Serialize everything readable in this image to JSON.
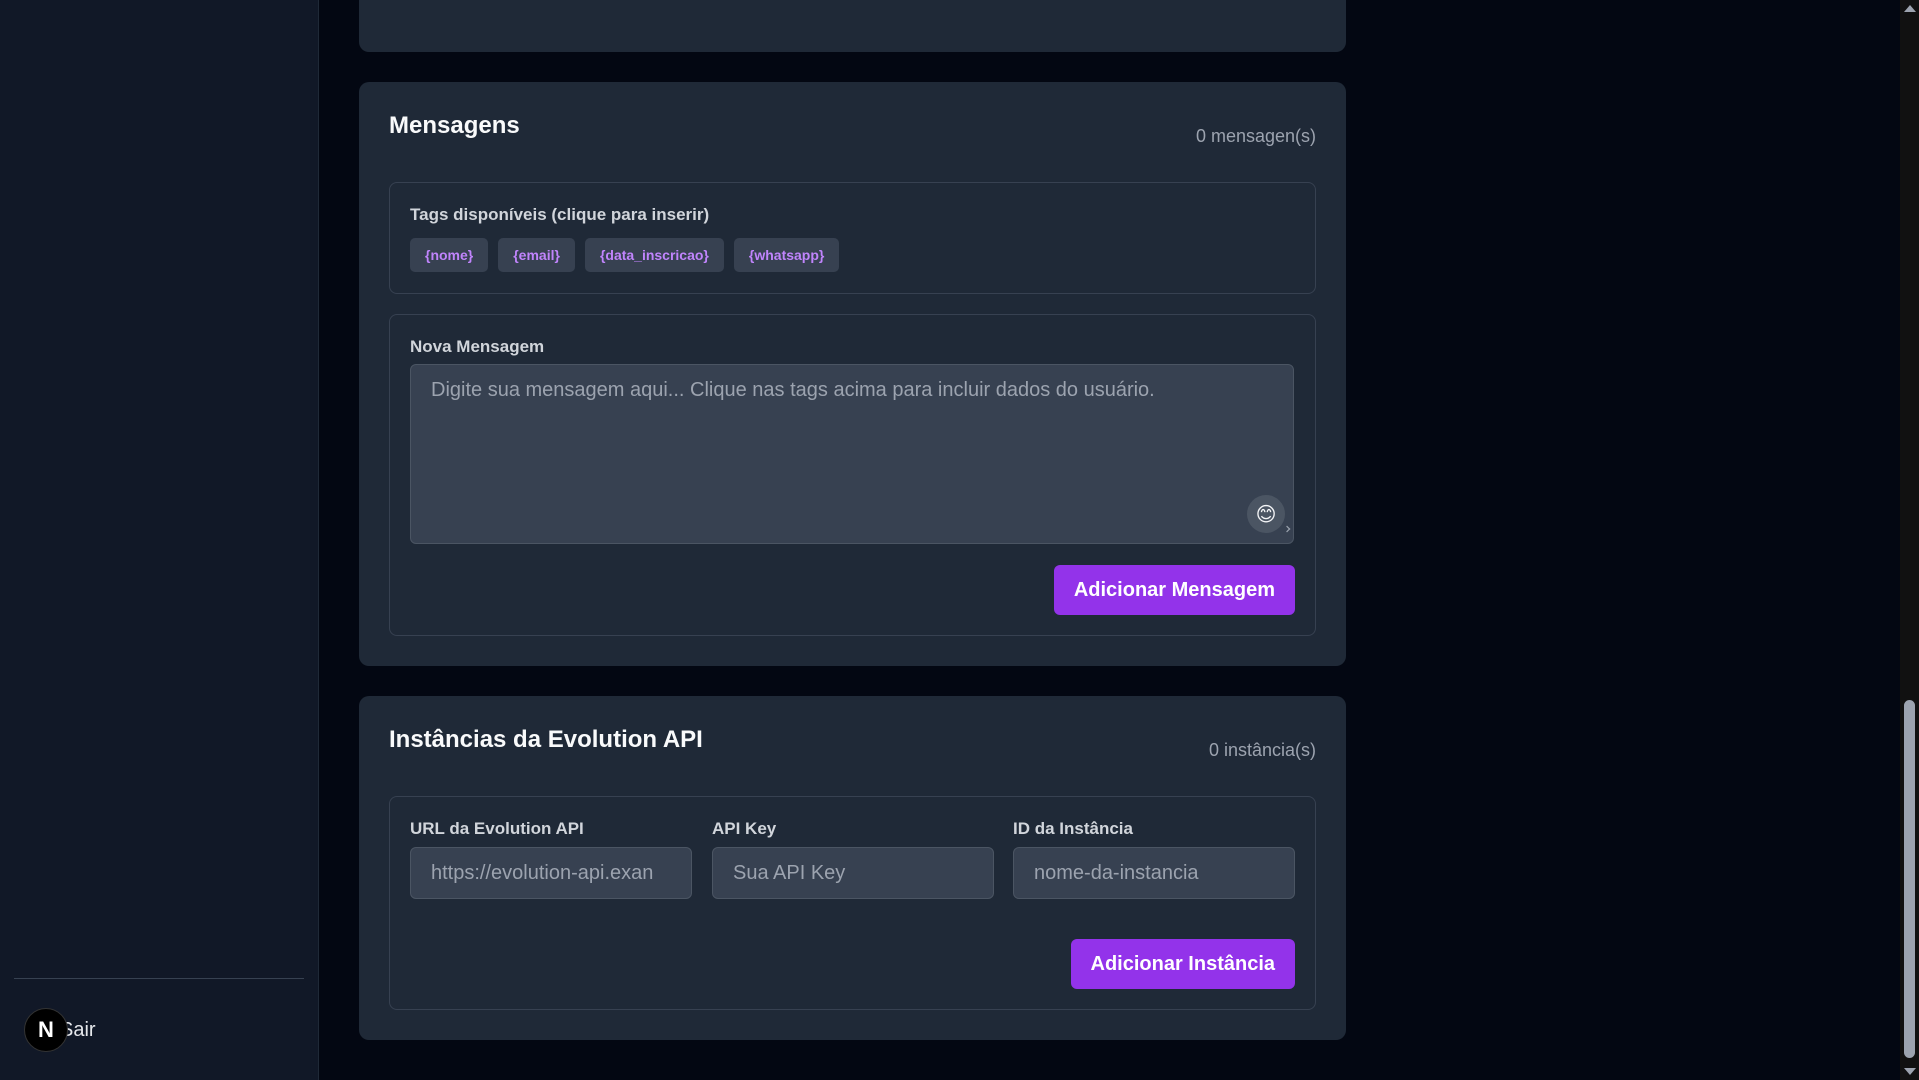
{
  "sidebar": {
    "logout_label": "Sair",
    "badge_letter": "N"
  },
  "messages": {
    "title": "Mensagens",
    "count": "0 mensagen(s)",
    "tags_label": "Tags disponíveis (clique para inserir)",
    "tags": [
      "{nome}",
      "{email}",
      "{data_inscricao}",
      "{whatsapp}"
    ],
    "new_label": "Nova Mensagem",
    "placeholder": "Digite sua mensagem aqui... Clique nas tags acima para incluir dados do usuário.",
    "emoji": "😊",
    "add_button": "Adicionar Mensagem"
  },
  "instances": {
    "title": "Instâncias da Evolution API",
    "count": "0 instância(s)",
    "url_label": "URL da Evolution API",
    "url_placeholder": "https://evolution-api.exan",
    "key_label": "API Key",
    "key_placeholder": "Sua API Key",
    "id_label": "ID da Instância",
    "id_placeholder": "nome-da-instancia",
    "add_button": "Adicionar Instância"
  },
  "colors": {
    "accent": "#9333ea",
    "tag_text": "#c084fc",
    "card_bg": "#1f2937",
    "page_bg": "#030712"
  }
}
